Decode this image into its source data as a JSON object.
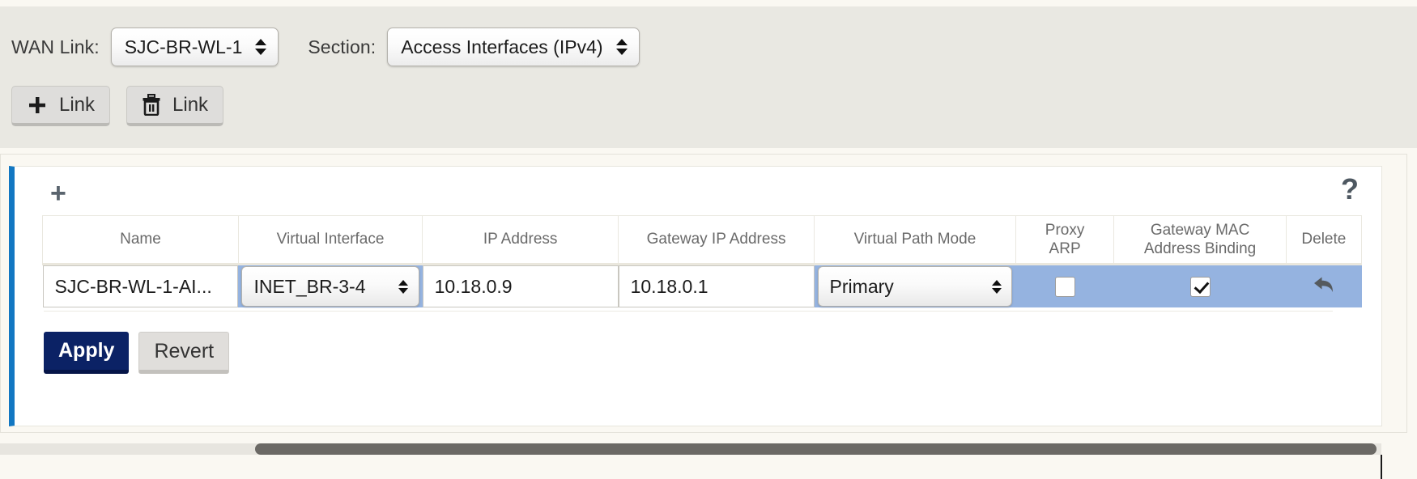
{
  "toolbar": {
    "wan_link_label": "WAN Link:",
    "wan_link_value": "SJC-BR-WL-1",
    "section_label": "Section:",
    "section_value": "Access Interfaces (IPv4)",
    "add_link_label": "Link",
    "add_link_icon": "plus-icon",
    "delete_link_label": "Link",
    "delete_link_icon": "trash-icon"
  },
  "panel": {
    "add_row_icon": "plus-icon",
    "add_row_label": "+",
    "help_icon": "question-mark-icon",
    "help_label": "?",
    "accent_color": "#1277c2"
  },
  "table": {
    "headers": [
      "Name",
      "Virtual Interface",
      "IP Address",
      "Gateway IP Address",
      "Virtual Path Mode",
      "Proxy\nARP",
      "Gateway MAC\nAddress Binding",
      "Delete"
    ],
    "header_proxy_arp_line1": "Proxy",
    "header_proxy_arp_line2": "ARP",
    "header_gw_mac_line1": "Gateway MAC",
    "header_gw_mac_line2": "Address Binding",
    "rows": [
      {
        "name": "SJC-BR-WL-1-AI...",
        "virtual_interface": "INET_BR-3-4",
        "ip_address": "10.18.0.9",
        "gateway_ip_address": "10.18.0.1",
        "virtual_path_mode": "Primary",
        "proxy_arp": false,
        "gateway_mac_address_binding": true,
        "delete_icon": "undo-arrow-icon",
        "row_highlight_color": "#95b3e0"
      }
    ]
  },
  "footer": {
    "apply_label": "Apply",
    "revert_label": "Revert",
    "apply_color": "#0b2265"
  },
  "scrollbar": {
    "orientation": "horizontal",
    "thumb_color": "#6b6965"
  }
}
